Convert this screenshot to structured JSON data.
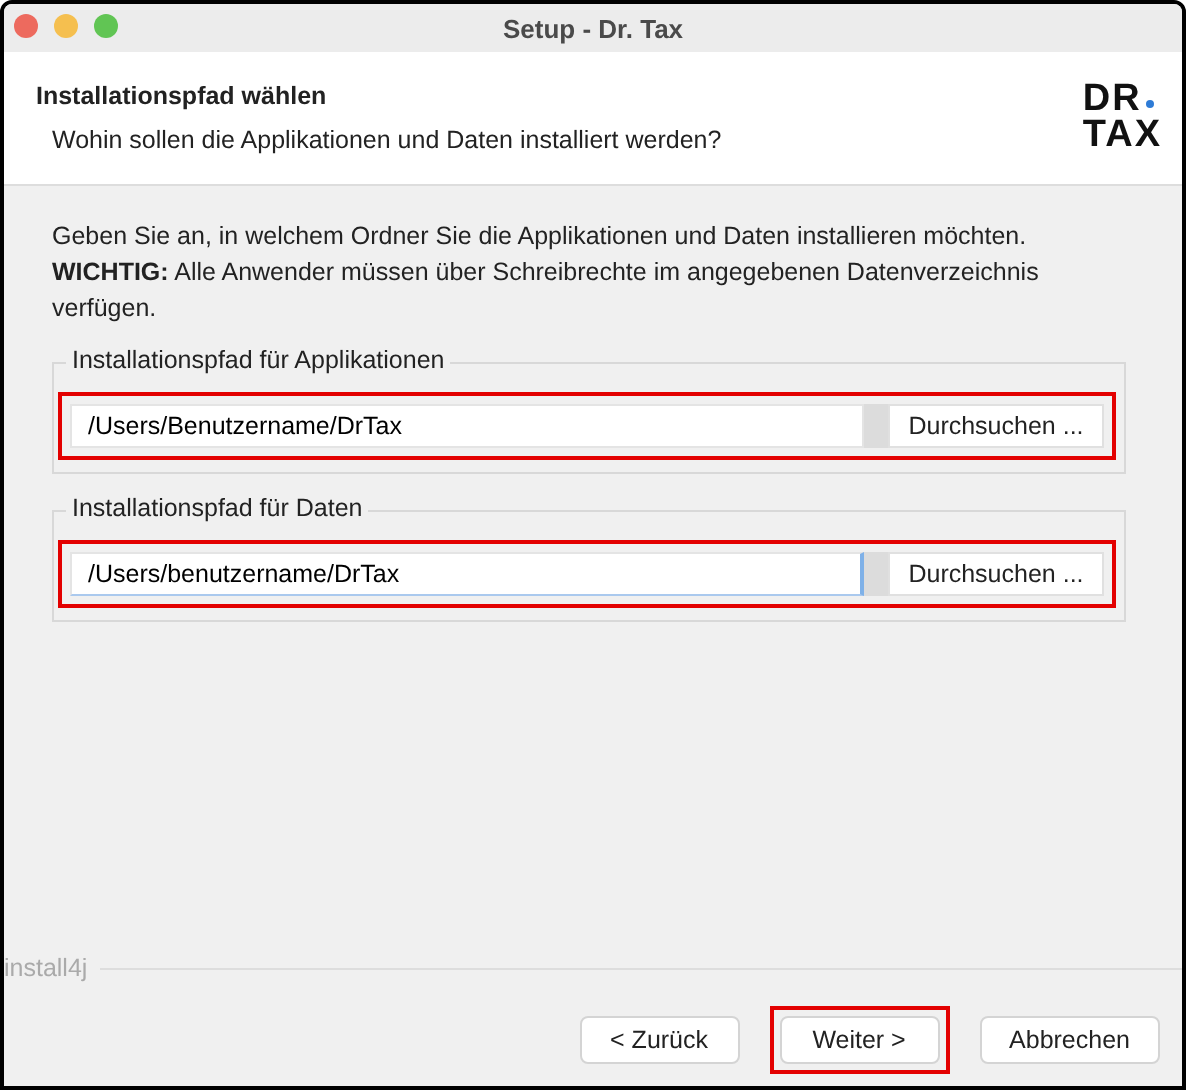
{
  "window": {
    "title": "Setup - Dr. Tax"
  },
  "header": {
    "title": "Installationspfad wählen",
    "subtitle": "Wohin sollen die Applikationen und Daten installiert werden?",
    "logo": {
      "line1": "DR",
      "line2": "TAX"
    }
  },
  "intro": "Geben Sie an, in welchem Ordner Sie die Applikationen und Daten installieren möchten. **WICHTIG:** Alle Anwender müssen über Schreibrechte im angegebenen Datenverzeichnis verfügen.",
  "groups": [
    {
      "legend": "Installationspfad für Applikationen",
      "value": "/Users/Benutzername/DrTax",
      "focused": false,
      "button": "Durchsuchen ...",
      "highlighted": true
    },
    {
      "legend": "Installationspfad für Daten",
      "value": "/Users/benutzername/DrTax",
      "focused": true,
      "button": "Durchsuchen ...",
      "highlighted": true
    }
  ],
  "footer": {
    "brand": "install4j"
  },
  "buttons": [
    {
      "label": "< Zurück",
      "highlighted": false
    },
    {
      "label": "Weiter >",
      "highlighted": true
    },
    {
      "label": "Abbrechen",
      "highlighted": false
    }
  ]
}
